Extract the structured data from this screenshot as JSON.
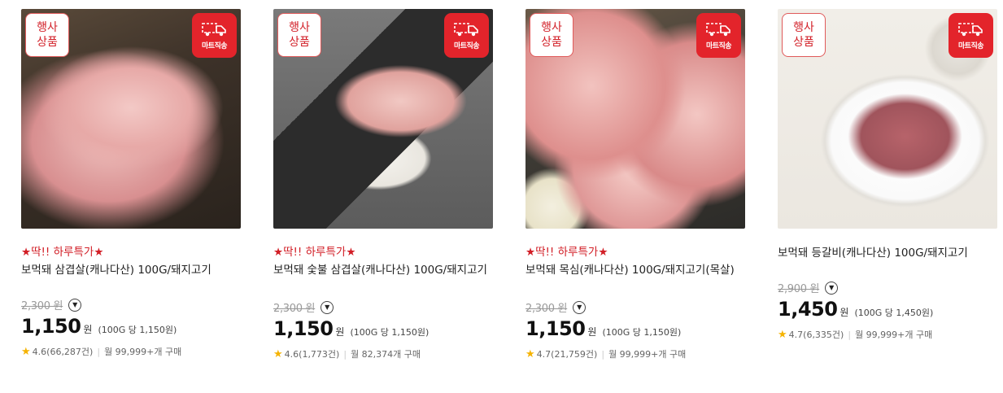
{
  "products": [
    {
      "event_badge": "행사\n상품",
      "delivery_badge": "마트직송",
      "promo": "★딱!! 하루특가★",
      "title": "보먹돼 삼겹살(캐나다산) 100G/돼지고기",
      "original_price": "2,300 원",
      "price": "1,150",
      "currency": "원",
      "unit_price": "(100G 당 1,150원)",
      "rating": "4.6(66,287건)",
      "purchases": "월 99,999+개 구매"
    },
    {
      "event_badge": "행사\n상품",
      "delivery_badge": "마트직송",
      "promo": "★딱!! 하루특가★",
      "title": "보먹돼 숯불 삼겹살(캐나다산) 100G/돼지고기",
      "original_price": "2,300 원",
      "price": "1,150",
      "currency": "원",
      "unit_price": "(100G 당 1,150원)",
      "rating": "4.6(1,773건)",
      "purchases": "월 82,374개 구매"
    },
    {
      "event_badge": "행사\n상품",
      "delivery_badge": "마트직송",
      "promo": "★딱!! 하루특가★",
      "title": "보먹돼 목심(캐나다산) 100G/돼지고기(목살)",
      "original_price": "2,300 원",
      "price": "1,150",
      "currency": "원",
      "unit_price": "(100G 당 1,150원)",
      "rating": "4.7(21,759건)",
      "purchases": "월 99,999+개 구매"
    },
    {
      "event_badge": "행사\n상품",
      "delivery_badge": "마트직송",
      "promo": "",
      "title": "보먹돼 등갈비(캐나다산) 100G/돼지고기",
      "original_price": "2,900 원",
      "price": "1,450",
      "currency": "원",
      "unit_price": "(100G 당 1,450원)",
      "rating": "4.7(6,335건)",
      "purchases": "월 99,999+개 구매"
    }
  ],
  "icons": {
    "delivery": "delivery-truck-icon",
    "more": "chevron-down-icon",
    "rating": "star-icon"
  },
  "colors": {
    "accent": "#d21f27",
    "badge_bg": "#e3242b",
    "star": "#f5b301"
  }
}
